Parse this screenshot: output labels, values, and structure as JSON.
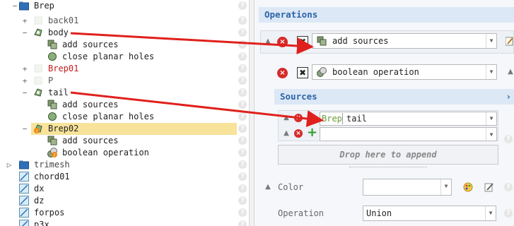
{
  "tree": {
    "items": [
      {
        "label": "Brep",
        "expander": "−",
        "icon": "folder-icon",
        "color": "#222"
      },
      {
        "label": "back01",
        "expander": "+",
        "icon": "object-icon",
        "color": "#555"
      },
      {
        "label": "body",
        "expander": "−",
        "icon": "region-icon",
        "color": "#222"
      },
      {
        "label": "add sources",
        "expander": "",
        "icon": "add-sources-icon",
        "color": "#222"
      },
      {
        "label": "close planar holes",
        "expander": "",
        "icon": "close-holes-icon",
        "color": "#222"
      },
      {
        "label": "Brep01",
        "expander": "+",
        "icon": "object-icon",
        "color": "#c21a1a"
      },
      {
        "label": "P",
        "expander": "+",
        "icon": "object-icon",
        "color": "#555"
      },
      {
        "label": "tail",
        "expander": "−",
        "icon": "region-icon",
        "color": "#222"
      },
      {
        "label": "add sources",
        "expander": "",
        "icon": "add-sources-icon",
        "color": "#222"
      },
      {
        "label": "close planar holes",
        "expander": "",
        "icon": "close-holes-icon",
        "color": "#222"
      },
      {
        "label": "Brep02",
        "expander": "−",
        "icon": "region-warning-icon",
        "color": "#222"
      },
      {
        "label": "add sources",
        "expander": "",
        "icon": "add-sources-icon",
        "color": "#222"
      },
      {
        "label": "boolean operation",
        "expander": "",
        "icon": "boolean-warning-icon",
        "color": "#222"
      },
      {
        "label": "trimesh",
        "expander": "▷",
        "icon": "folder-icon",
        "color": "#444"
      },
      {
        "label": "chord01",
        "expander": "",
        "icon": "sketch-icon",
        "color": "#222"
      },
      {
        "label": "dx",
        "expander": "",
        "icon": "sketch-icon",
        "color": "#222"
      },
      {
        "label": "dz",
        "expander": "",
        "icon": "sketch-icon",
        "color": "#222"
      },
      {
        "label": "forpos",
        "expander": "",
        "icon": "sketch-icon",
        "color": "#222"
      },
      {
        "label": "p3x",
        "expander": "",
        "icon": "sketch-icon",
        "color": "#222"
      }
    ],
    "help_glyph": "?"
  },
  "panel": {
    "operations_title": "Operations",
    "ops": [
      {
        "label": "add sources",
        "icon": "add-sources-icon",
        "remove": "×",
        "toggle": "✖"
      },
      {
        "label": "boolean operation",
        "icon": "boolean-icon",
        "remove": "×",
        "toggle": "✖"
      }
    ],
    "sources_title": "Sources",
    "sources_collapse": "›",
    "source_entries": [
      {
        "prefix": "Brep",
        "value": "tail"
      },
      {
        "prefix": "",
        "value": ""
      }
    ],
    "add_glyph": "+",
    "drop_text": "Drop here to append",
    "color_label": "Color",
    "operation_label": "Operation",
    "operation_value": "Union",
    "help_glyph": "?"
  },
  "colors": {
    "accent": "#2c64a8",
    "selection": "#f7e39a",
    "error": "#d62a2a",
    "arrow": "#e0201c"
  }
}
